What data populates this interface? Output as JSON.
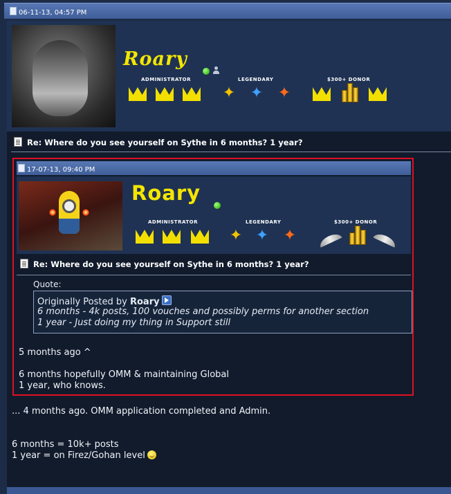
{
  "outer_post": {
    "date": "06-11-13, 04:57 PM",
    "username": "Roary",
    "ranks": {
      "administrator": "ADMINISTRATOR",
      "legendary": "LEGENDARY",
      "donor": "$300+ DONOR"
    },
    "title": "Re: Where do you see yourself on Sythe in 6 months? 1 year?",
    "body": [
      "... 4 months ago. OMM application completed and Admin.",
      "6 months = 10k+ posts",
      "1 year = on Firez/Gohan level"
    ]
  },
  "quoted_post": {
    "date": "17-07-13, 09:40 PM",
    "username": "Roary",
    "ranks": {
      "administrator": "ADMINISTRATOR",
      "legendary": "LEGENDARY",
      "donor": "$300+ DONOR"
    },
    "title": "Re: Where do you see yourself on Sythe in 6 months? 1 year?",
    "quote_label": "Quote:",
    "quote_prefix": "Originally Posted by",
    "quote_author": "Roary",
    "quote_lines": [
      "6 months - 4k posts, 100 vouches and possibly perms for another section",
      "1 year - Just doing my thing in Support still"
    ],
    "body": [
      "5 months ago ^",
      "6 months hopefully OMM & maintaining Global",
      "1 year, who knows."
    ]
  },
  "icons": {
    "post_date_icon": "document-icon",
    "online_icon": "online-status-icon",
    "user_icon": "user-profile-icon",
    "post_title_icon": "page-icon",
    "view_post_icon": "arrow-right-icon",
    "smiley_icon": "smile-icon"
  },
  "colors": {
    "accent": "#3f5e99",
    "highlight_border": "#e01020",
    "username": "#f4e600"
  }
}
